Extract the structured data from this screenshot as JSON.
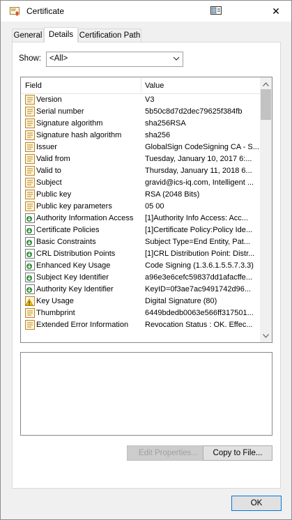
{
  "window": {
    "title": "Certificate",
    "icons": {
      "title": "certificate-icon",
      "extra": "window-extra-icon",
      "close": "close-icon"
    }
  },
  "tabs": [
    {
      "label": "General",
      "active": false
    },
    {
      "label": "Details",
      "active": true
    },
    {
      "label": "Certification Path",
      "active": false
    }
  ],
  "show": {
    "label": "Show:",
    "selected": "<All>"
  },
  "grid": {
    "header_field": "Field",
    "header_value": "Value",
    "rows": [
      {
        "field": "Version",
        "value": "V3",
        "icon": "document-icon"
      },
      {
        "field": "Serial number",
        "value": "5b50c8d7d2dec79625f384fb",
        "icon": "document-icon"
      },
      {
        "field": "Signature algorithm",
        "value": "sha256RSA",
        "icon": "document-icon"
      },
      {
        "field": "Signature hash algorithm",
        "value": "sha256",
        "icon": "document-icon"
      },
      {
        "field": "Issuer",
        "value": "GlobalSign CodeSigning CA - S...",
        "icon": "document-icon"
      },
      {
        "field": "Valid from",
        "value": "Tuesday, January 10, 2017 6:...",
        "icon": "document-icon"
      },
      {
        "field": "Valid to",
        "value": "Thursday, January 11, 2018 6...",
        "icon": "document-icon"
      },
      {
        "field": "Subject",
        "value": "gravid@ics-iq.com, Intelligent ...",
        "icon": "document-icon"
      },
      {
        "field": "Public key",
        "value": "RSA (2048 Bits)",
        "icon": "document-icon"
      },
      {
        "field": "Public key parameters",
        "value": "05 00",
        "icon": "document-icon"
      },
      {
        "field": "Authority Information Access",
        "value": "[1]Authority Info Access: Acc...",
        "icon": "extension-icon"
      },
      {
        "field": "Certificate Policies",
        "value": "[1]Certificate Policy:Policy Ide...",
        "icon": "extension-icon"
      },
      {
        "field": "Basic Constraints",
        "value": "Subject Type=End Entity, Pat...",
        "icon": "extension-icon"
      },
      {
        "field": "CRL Distribution Points",
        "value": "[1]CRL Distribution Point: Distr...",
        "icon": "extension-icon"
      },
      {
        "field": "Enhanced Key Usage",
        "value": "Code Signing (1.3.6.1.5.5.7.3.3)",
        "icon": "extension-icon"
      },
      {
        "field": "Subject Key Identifier",
        "value": "a96e3e6cefc59837dd1afacffe...",
        "icon": "extension-icon"
      },
      {
        "field": "Authority Key Identifier",
        "value": "KeyID=0f3ae7ac9491742d96...",
        "icon": "extension-icon"
      },
      {
        "field": "Key Usage",
        "value": "Digital Signature (80)",
        "icon": "warning-icon"
      },
      {
        "field": "Thumbprint",
        "value": "6449bdedb0063e566ff317501...",
        "icon": "document-icon"
      },
      {
        "field": "Extended Error Information",
        "value": "Revocation Status : OK. Effec...",
        "icon": "document-icon"
      }
    ]
  },
  "buttons": {
    "edit_properties": "Edit Properties...",
    "copy_to_file": "Copy to File...",
    "ok": "OK"
  }
}
